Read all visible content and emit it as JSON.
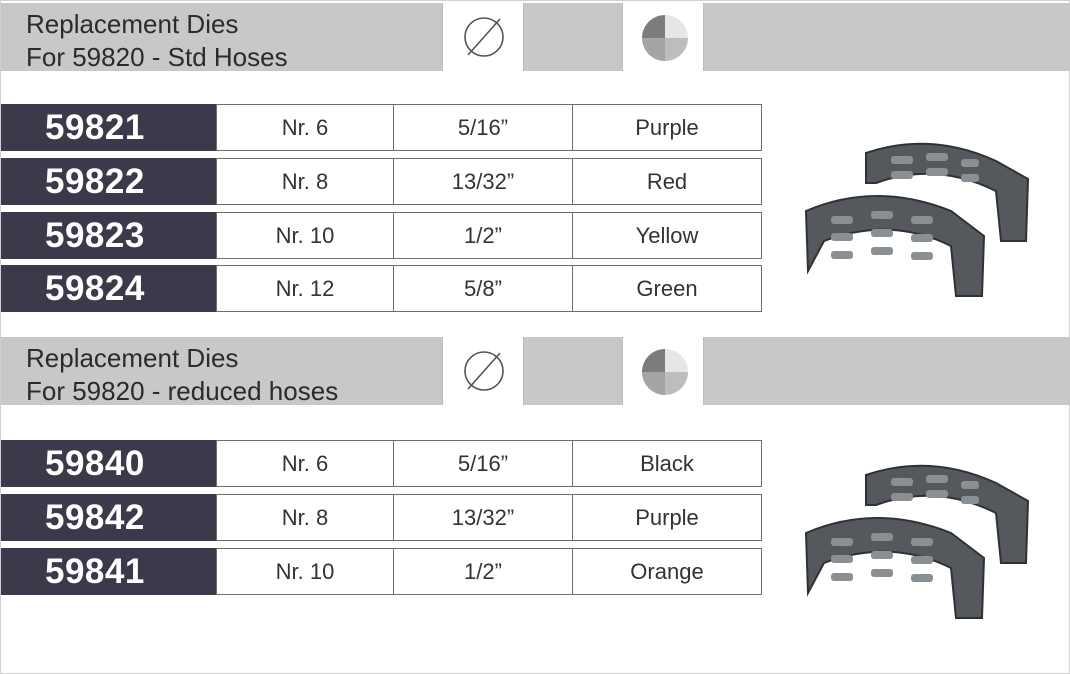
{
  "sections": [
    {
      "title_line1": "Replacement Dies",
      "title_line2": "For 59820 - Std Hoses",
      "diameter_icon": "diameter-symbol-icon",
      "color_icon": "color-wheel-icon",
      "rows": [
        {
          "code": "59821",
          "size": "Nr. 6",
          "diameter": "5/16”",
          "color": "Purple"
        },
        {
          "code": "59822",
          "size": "Nr. 8",
          "diameter": "13/32”",
          "color": "Red"
        },
        {
          "code": "59823",
          "size": "Nr. 10",
          "diameter": "1/2”",
          "color": "Yellow"
        },
        {
          "code": "59824",
          "size": "Nr. 12",
          "diameter": "5/8”",
          "color": "Green"
        }
      ]
    },
    {
      "title_line1": "Replacement Dies",
      "title_line2": "For 59820 - reduced hoses",
      "diameter_icon": "diameter-symbol-icon",
      "color_icon": "color-wheel-icon",
      "rows": [
        {
          "code": "59840",
          "size": "Nr. 6",
          "diameter": "5/16”",
          "color": "Black"
        },
        {
          "code": "59842",
          "size": "Nr. 8",
          "diameter": "13/32”",
          "color": "Purple"
        },
        {
          "code": "59841",
          "size": "Nr. 10",
          "diameter": "1/2”",
          "color": "Orange"
        }
      ]
    }
  ],
  "colors": {
    "band": "#c8c8c8",
    "code_cell": "#3a3a4a",
    "cell_border": "#6f6f6f",
    "die_metal": "#5a5e62"
  }
}
